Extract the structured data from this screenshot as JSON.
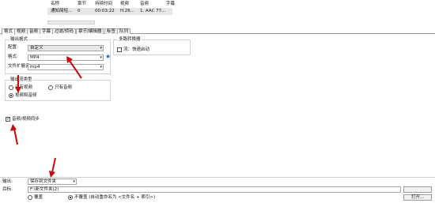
{
  "file_list": {
    "columns": [
      "名称",
      "章节",
      "持续时间",
      "视频",
      "音频",
      "字幕"
    ],
    "row": {
      "name": "通知简短...",
      "chapters": "0",
      "duration": "00:03:22",
      "video": "H.26...",
      "audio": "1. AAC 77..."
    }
  },
  "tabs": [
    {
      "label": "格式",
      "active": true
    },
    {
      "label": "视频",
      "active": false
    },
    {
      "label": "音频",
      "active": false
    },
    {
      "label": "字幕",
      "active": false
    },
    {
      "label": "过滤/转码",
      "active": false
    },
    {
      "label": "章节/编辑器",
      "active": false
    },
    {
      "label": "标签",
      "active": false
    },
    {
      "label": "队列",
      "active": false
    }
  ],
  "output_format": {
    "title": "输出格式",
    "preset_label": "配置:",
    "preset_value": "自定义",
    "format_label": "格式:",
    "format_value": "MP4",
    "ext_label": "文件扩展名:",
    "ext_value": "mp4"
  },
  "multi_pass": {
    "title": "多路转换器",
    "fast_start_label": "流：快速启动",
    "fast_start_checked": false
  },
  "output_type": {
    "title": "输出流类型",
    "only_video": "只有视频",
    "only_audio": "只有音频",
    "video_audio": "视频和音频",
    "selected": "video_audio"
  },
  "av_sync": {
    "label": "音频/视频同步",
    "checked": true
  },
  "bottom": {
    "output_label": "输出:",
    "output_value": "保存到文件夹",
    "dest_label": "目标:",
    "dest_value": "F:\\新文件夹(2)",
    "overwrite_label": "覆盖",
    "no_overwrite_label": "不覆盖 (自动重命名为 <文件名 + 索引>)",
    "open_button": "打开..."
  },
  "colors": {
    "annotation_red": "#cc0a0a",
    "star_blue": "#1f5fd6"
  }
}
